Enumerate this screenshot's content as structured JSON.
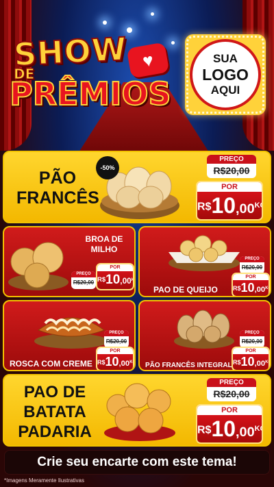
{
  "header": {
    "title_line1": "SHOW",
    "title_line2": "DE",
    "title_line3": "PRÊMIOS",
    "logo_line1": "SUA",
    "logo_line2": "LOGO",
    "logo_line3": "AQUI"
  },
  "products": [
    {
      "id": "pao-frances",
      "name_lines": [
        "PÃO",
        "FRANCÊS"
      ],
      "discount": "-50%",
      "old_label": "PREÇO",
      "old_price": "R$20,00",
      "new_label": "POR",
      "currency": "R$",
      "price_int": "10",
      "price_cents": ",00",
      "unit": "KG"
    },
    {
      "id": "broa-de-milho",
      "name_lines": [
        "BROA DE",
        "MILHO"
      ],
      "old_label": "PREÇO",
      "old_price": "R$20,00",
      "new_label": "POR",
      "currency": "R$",
      "price_int": "10",
      "price_cents": ",00",
      "unit": "KG"
    },
    {
      "id": "pao-de-queijo",
      "name_lines": [
        "PAO DE QUEIJO"
      ],
      "old_label": "PREÇO",
      "old_price": "R$20,00",
      "new_label": "POR",
      "currency": "R$",
      "price_int": "10",
      "price_cents": ",00",
      "unit": "KG"
    },
    {
      "id": "rosca-com-creme",
      "name_lines": [
        "ROSCA COM CREME"
      ],
      "old_label": "PREÇO",
      "old_price": "R$20,00",
      "new_label": "POR",
      "currency": "R$",
      "price_int": "10",
      "price_cents": ",00",
      "unit": "KG"
    },
    {
      "id": "pao-frances-integral",
      "name_lines": [
        "PÃO FRANCÊS INTEGRAL"
      ],
      "old_label": "PREÇO",
      "old_price": "R$20,00",
      "new_label": "POR",
      "currency": "R$",
      "price_int": "10",
      "price_cents": ",00",
      "unit": "KG"
    },
    {
      "id": "pao-de-batata",
      "name_lines": [
        "PAO DE",
        "BATATA",
        "PADARIA"
      ],
      "old_label": "PREÇO",
      "old_price": "R$20,00",
      "new_label": "POR",
      "currency": "R$",
      "price_int": "10",
      "price_cents": ",00",
      "unit": "KG"
    }
  ],
  "cta": "Crie seu encarte com este tema!",
  "footnote": "*Imagens Meramente Ilustrativas",
  "icons": [
    "heart-icon",
    "bread-basket-icon"
  ],
  "colors": {
    "brand_red": "#d11b1b",
    "brand_yellow": "#ffd62e",
    "dark": "#1b0606"
  }
}
